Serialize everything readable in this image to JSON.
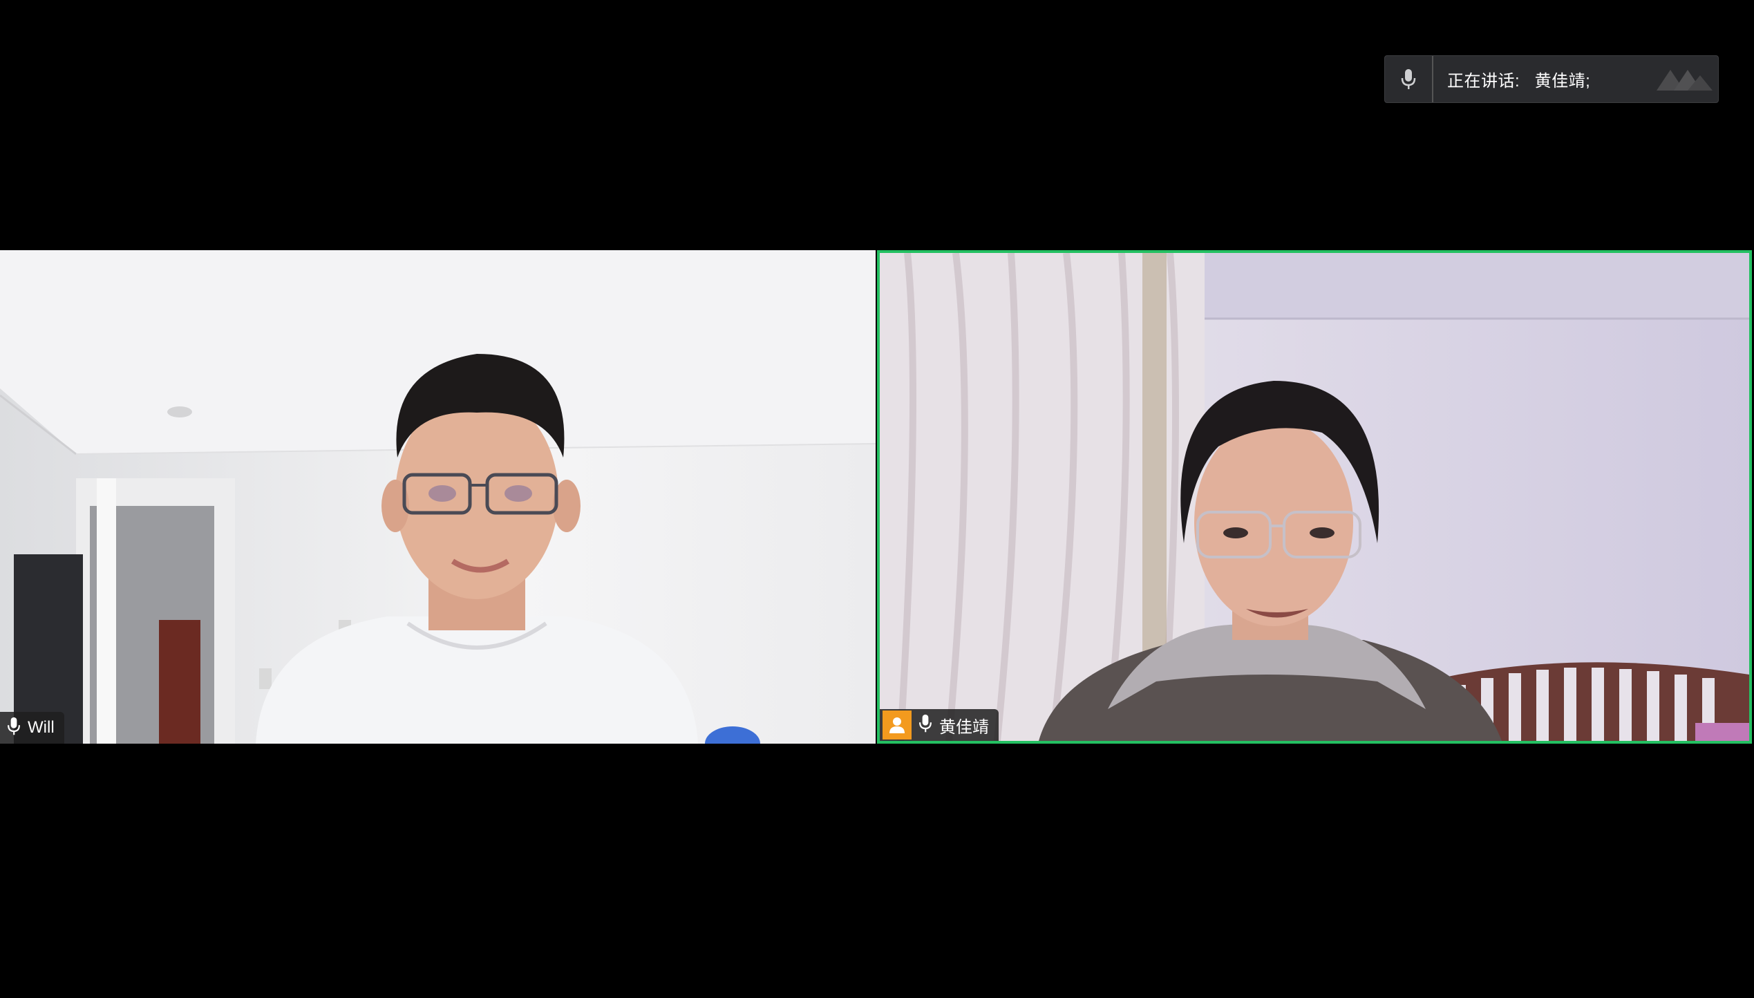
{
  "speaking_indicator": {
    "label": "正在讲话:   黄佳靖;",
    "mic_icon": "microphone-icon",
    "logo_icon": "app-logo-watermark"
  },
  "participants": [
    {
      "name": "Will",
      "mic_icon": "microphone-icon",
      "active_speaker": false
    },
    {
      "name": "黄佳靖",
      "mic_icon": "microphone-icon",
      "avatar_icon": "user-avatar-icon",
      "active_speaker": true
    }
  ],
  "colors": {
    "background": "#000000",
    "active_speaker_border": "#24c062",
    "avatar_badge": "#f39a1e"
  }
}
